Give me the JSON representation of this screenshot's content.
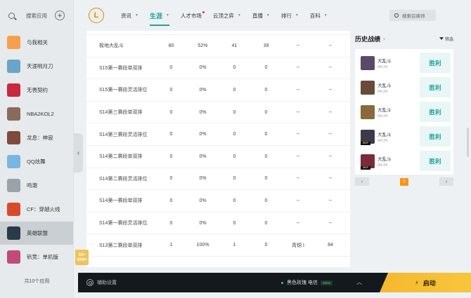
{
  "sidebar": {
    "search_label": "搜索应用",
    "items": [
      {
        "label": "与我相关",
        "color": "#f6a04d"
      },
      {
        "label": "天涯明月刀",
        "color": "#6aa4c9"
      },
      {
        "label": "无畏契约",
        "color": "#c9283e"
      },
      {
        "label": "NBA2KOL2",
        "color": "#8a6a5a"
      },
      {
        "label": "龙息：神寂",
        "color": "#7e4a3c"
      },
      {
        "label": "QQ炫舞",
        "color": "#79b6e0"
      },
      {
        "label": "鸣潮",
        "color": "#9ba3aa"
      },
      {
        "label": "CF：穿越火线",
        "color": "#d84b2a"
      },
      {
        "label": "英雄联盟",
        "color": "#2b3a48"
      },
      {
        "label": "钒竞：单机版",
        "color": "#c04a7a"
      }
    ],
    "footer": "共10个应用"
  },
  "nav": {
    "logo": "L",
    "items": [
      "资讯",
      "生涯",
      "人才市场",
      "云顶之弈",
      "直播",
      "排行",
      "百科"
    ],
    "active_index": 1,
    "search_placeholder": "搜索召唤师"
  },
  "table": {
    "rows": [
      {
        "mode": "极地大乱斗",
        "games": "80",
        "winrate": "52%",
        "kda": "41",
        "mvp": "39",
        "rank": "--",
        "lp": "--"
      },
      {
        "mode": "S15第一赛段单双排",
        "games": "0",
        "winrate": "0%",
        "kda": "0",
        "mvp": "0",
        "rank": "--",
        "lp": "--"
      },
      {
        "mode": "S15第一赛段灵活排位",
        "games": "0",
        "winrate": "0%",
        "kda": "0",
        "mvp": "0",
        "rank": "--",
        "lp": "--"
      },
      {
        "mode": "S14第三赛段单双排",
        "games": "0",
        "winrate": "0%",
        "kda": "0",
        "mvp": "0",
        "rank": "--",
        "lp": "--"
      },
      {
        "mode": "S14第三赛段灵活排位",
        "games": "0",
        "winrate": "0%",
        "kda": "0",
        "mvp": "0",
        "rank": "--",
        "lp": "--"
      },
      {
        "mode": "S14第二赛段单双排",
        "games": "0",
        "winrate": "0%",
        "kda": "0",
        "mvp": "0",
        "rank": "--",
        "lp": "--"
      },
      {
        "mode": "S14第二赛段灵活排位",
        "games": "0",
        "winrate": "0%",
        "kda": "0",
        "mvp": "0",
        "rank": "--",
        "lp": "--"
      },
      {
        "mode": "S14第一赛段单双排",
        "games": "0",
        "winrate": "0%",
        "kda": "0",
        "mvp": "0",
        "rank": "--",
        "lp": "--"
      },
      {
        "mode": "S14第一赛段灵活排位",
        "games": "0",
        "winrate": "0%",
        "kda": "0",
        "mvp": "0",
        "rank": "--",
        "lp": "--"
      },
      {
        "mode": "S13第二赛段单双排",
        "games": "1",
        "winrate": "100%",
        "kda": "1",
        "mvp": "0",
        "rank": "青铜 I",
        "lp": "84"
      }
    ]
  },
  "side_badge": {
    "age": "16+",
    "sub": "适龄提示"
  },
  "history": {
    "title": "历史战绩",
    "filter": "筛选",
    "matches": [
      {
        "mode": "大乱斗",
        "date": "04-24",
        "result": "胜利",
        "color": "#5a4a6a",
        "mvp": false
      },
      {
        "mode": "大乱斗",
        "date": "04-24",
        "result": "胜利",
        "color": "#6a4a3a",
        "mvp": false
      },
      {
        "mode": "大乱斗",
        "date": "04-24",
        "result": "胜利",
        "color": "#8a6a3a",
        "mvp": false
      },
      {
        "mode": "大乱斗",
        "date": "04-24",
        "result": "胜利",
        "color": "#3a3a4a",
        "mvp": true
      },
      {
        "mode": "大乱斗",
        "date": "04-24",
        "result": "胜利",
        "color": "#7a2a3a",
        "mvp": true
      }
    ],
    "page": "1",
    "mvp_label": "MVP"
  },
  "bottom": {
    "settings": "辅助设置",
    "server": "黑色玫瑰 电信",
    "ping": "40ms",
    "launch": "启动"
  }
}
